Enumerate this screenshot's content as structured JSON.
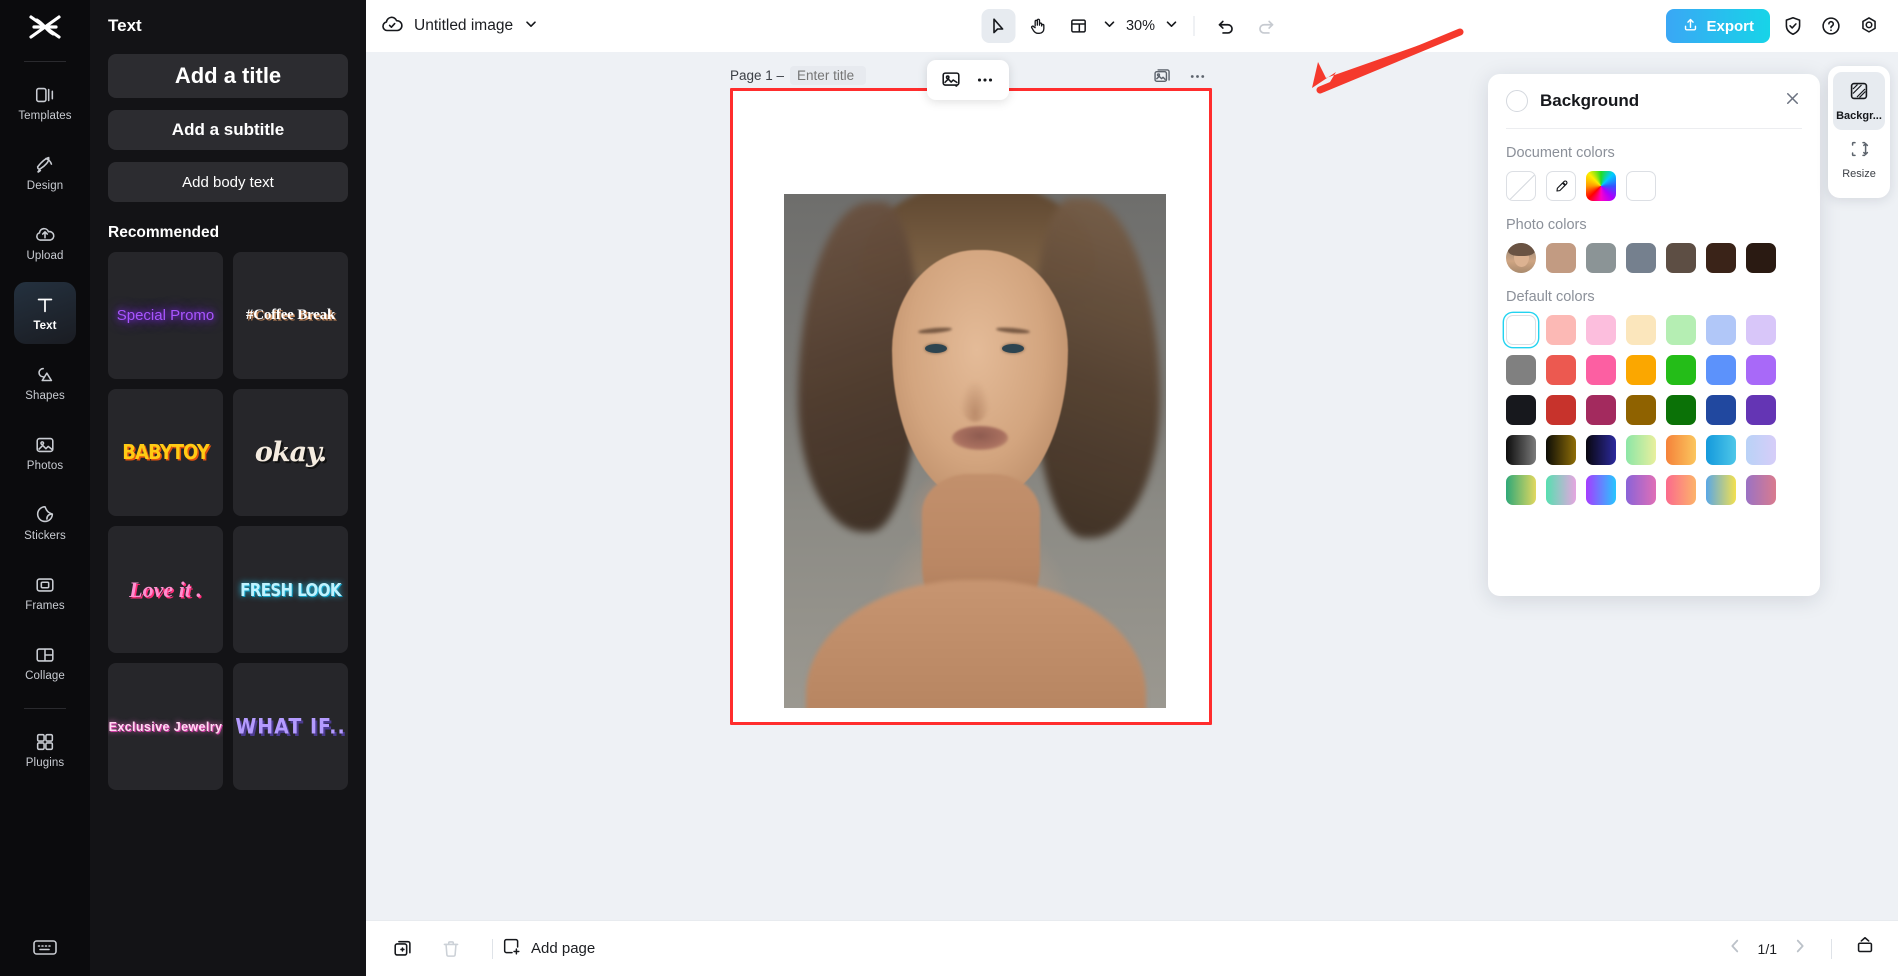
{
  "rail": {
    "logo_icon": "capcut-logo-icon",
    "items": [
      {
        "label": "Templates",
        "icon": "templates-icon",
        "active": false
      },
      {
        "label": "Design",
        "icon": "design-icon",
        "active": false
      },
      {
        "label": "Upload",
        "icon": "upload-cloud-icon",
        "active": false
      },
      {
        "label": "Text",
        "icon": "text-icon",
        "active": true
      },
      {
        "label": "Shapes",
        "icon": "shapes-icon",
        "active": false
      },
      {
        "label": "Photos",
        "icon": "photos-icon",
        "active": false
      },
      {
        "label": "Stickers",
        "icon": "stickers-icon",
        "active": false
      },
      {
        "label": "Frames",
        "icon": "frames-icon",
        "active": false
      },
      {
        "label": "Collage",
        "icon": "collage-icon",
        "active": false
      },
      {
        "label": "Plugins",
        "icon": "plugins-icon",
        "active": false
      }
    ],
    "bottom_icon": "keyboard-icon"
  },
  "panel": {
    "title": "Text",
    "buttons": [
      {
        "label": "Add a title"
      },
      {
        "label": "Add a subtitle"
      },
      {
        "label": "Add body text"
      }
    ],
    "section_title": "Recommended",
    "cards": [
      {
        "label": "Special Promo",
        "style": "s-special"
      },
      {
        "label": "#Coffee Break",
        "style": "s-coffee"
      },
      {
        "label": "BABYTOY",
        "style": "s-baby"
      },
      {
        "label": "okay.",
        "style": "s-okay"
      },
      {
        "label": "Love it .",
        "style": "s-love"
      },
      {
        "label": "FRESH LOOK",
        "style": "s-fresh"
      },
      {
        "label": "Exclusive Jewelry",
        "style": "s-jewel"
      },
      {
        "label": "WHAT IF..",
        "style": "s-what"
      }
    ]
  },
  "topbar": {
    "cloud_icon": "cloud-saved-icon",
    "doc_title": "Untitled image",
    "title_caret_icon": "chevron-down-icon",
    "select_tool_icon": "cursor-select-icon",
    "hand_tool_icon": "hand-pan-icon",
    "layout_tool_icon": "layout-grid-icon",
    "layout_caret_icon": "chevron-down-icon",
    "zoom_value": "30%",
    "zoom_caret_icon": "chevron-down-icon",
    "undo_icon": "undo-icon",
    "redo_icon": "redo-icon",
    "export_label": "Export",
    "export_icon": "upload-share-icon",
    "shield_icon": "shield-check-icon",
    "help_icon": "question-circle-icon",
    "settings_icon": "gear-icon",
    "export_color": "#2fc6ea"
  },
  "canvas": {
    "page_label": "Page 1 –",
    "page_title_placeholder": "Enter title",
    "page_title_value": "",
    "float_image_icon": "image-edit-icon",
    "float_more_icon": "more-dots-icon",
    "duplicate_icon": "duplicate-page-icon",
    "more_icon": "more-dots-icon",
    "selection_color": "#ff2d2d",
    "selection_inner_color": "#25d3ef"
  },
  "bottombar": {
    "duplicate_icon": "duplicate-page-icon",
    "delete_icon": "trash-icon",
    "add_page_icon": "add-page-icon",
    "add_page_label": "Add page",
    "prev_icon": "chevron-left-icon",
    "page_indicator": "1/1",
    "next_icon": "chevron-right-icon",
    "timeline_icon": "page-panel-icon"
  },
  "background_panel": {
    "title": "Background",
    "close_icon": "close-icon",
    "sections": {
      "document_colors": {
        "label": "Document colors",
        "swatches": [
          {
            "name": "no-color",
            "type": "none"
          },
          {
            "name": "eyedropper",
            "type": "picker"
          },
          {
            "name": "color-wheel",
            "type": "wheel"
          },
          {
            "name": "white",
            "type": "solid",
            "color": "#ffffff"
          }
        ]
      },
      "photo_colors": {
        "label": "Photo colors",
        "swatches": [
          {
            "name": "photo-thumbnail",
            "type": "avatar"
          },
          {
            "name": "tan",
            "type": "solid",
            "color": "#c29b82"
          },
          {
            "name": "slate-gray",
            "type": "solid",
            "color": "#8b9496"
          },
          {
            "name": "blue-gray",
            "type": "solid",
            "color": "#75808e"
          },
          {
            "name": "taupe",
            "type": "solid",
            "color": "#5d4e44"
          },
          {
            "name": "dark-brown",
            "type": "solid",
            "color": "#3a2318"
          },
          {
            "name": "near-black",
            "type": "solid",
            "color": "#2a1a12"
          }
        ]
      },
      "default_colors": {
        "label": "Default colors",
        "rows": [
          [
            {
              "name": "white",
              "type": "solid",
              "color": "#ffffff",
              "selected": true
            },
            {
              "name": "light-red",
              "type": "solid",
              "color": "#fcb9b5"
            },
            {
              "name": "light-pink",
              "type": "solid",
              "color": "#fcbedd"
            },
            {
              "name": "light-cream",
              "type": "solid",
              "color": "#fbe6bc"
            },
            {
              "name": "light-green",
              "type": "solid",
              "color": "#b5eeb3"
            },
            {
              "name": "light-blue",
              "type": "solid",
              "color": "#b1c7f8"
            },
            {
              "name": "light-purple",
              "type": "solid",
              "color": "#d8c6f9"
            }
          ],
          [
            {
              "name": "gray",
              "type": "solid",
              "color": "#808080"
            },
            {
              "name": "red",
              "type": "solid",
              "color": "#ec5950"
            },
            {
              "name": "pink",
              "type": "solid",
              "color": "#fc5fa2"
            },
            {
              "name": "orange",
              "type": "solid",
              "color": "#fba700"
            },
            {
              "name": "green",
              "type": "solid",
              "color": "#24bd18"
            },
            {
              "name": "blue",
              "type": "solid",
              "color": "#5c92fb"
            },
            {
              "name": "purple",
              "type": "solid",
              "color": "#a869f8"
            }
          ],
          [
            {
              "name": "black",
              "type": "solid",
              "color": "#17181d"
            },
            {
              "name": "dark-red",
              "type": "solid",
              "color": "#c7332c"
            },
            {
              "name": "magenta",
              "type": "solid",
              "color": "#a32a5e"
            },
            {
              "name": "dark-gold",
              "type": "solid",
              "color": "#8f6200"
            },
            {
              "name": "dark-green",
              "type": "solid",
              "color": "#0b7207"
            },
            {
              "name": "dark-blue",
              "type": "solid",
              "color": "#21489f"
            },
            {
              "name": "dark-purple",
              "type": "solid",
              "color": "#6435b4"
            }
          ],
          [
            {
              "name": "gradient-black-gray",
              "type": "gradient",
              "color": "linear-gradient(90deg,#0c0c0c,#7b7b7b)"
            },
            {
              "name": "gradient-black-gold",
              "type": "gradient",
              "color": "linear-gradient(90deg,#0d0d07,#8f6e07)"
            },
            {
              "name": "gradient-black-navy",
              "type": "gradient",
              "color": "linear-gradient(90deg,#09070f,#2c2a9e)"
            },
            {
              "name": "gradient-green-yellow",
              "type": "gradient",
              "color": "linear-gradient(90deg,#8ce6a7,#e9ef9d)"
            },
            {
              "name": "gradient-orange-yellow",
              "type": "gradient",
              "color": "linear-gradient(90deg,#f5823a,#fbc65e)"
            },
            {
              "name": "gradient-blue-cyan",
              "type": "gradient",
              "color": "linear-gradient(90deg,#1499dc,#4ec7e8)"
            },
            {
              "name": "gradient-lightblue-lilac",
              "type": "gradient",
              "color": "linear-gradient(90deg,#b9d2f7,#d6cdf8)"
            }
          ],
          [
            {
              "name": "gradient-teal-yellow",
              "type": "gradient",
              "color": "linear-gradient(90deg,#2fa878,#e2d85f)"
            },
            {
              "name": "gradient-mint-pink",
              "type": "gradient",
              "color": "linear-gradient(90deg,#57dfb0,#e6a5e0)"
            },
            {
              "name": "gradient-purple-cyan",
              "type": "gradient",
              "color": "linear-gradient(90deg,#a63cff,#27c6ff)"
            },
            {
              "name": "gradient-violet-rose",
              "type": "gradient",
              "color": "linear-gradient(90deg,#8a63d8,#e06fb6)"
            },
            {
              "name": "gradient-pink-orange",
              "type": "gradient",
              "color": "linear-gradient(90deg,#fb6a8d,#fcb36a)"
            },
            {
              "name": "gradient-blue-yellow",
              "type": "gradient",
              "color": "linear-gradient(90deg,#59a7e6,#f3e04f)"
            },
            {
              "name": "gradient-rose-mauve",
              "type": "gradient",
              "color": "linear-gradient(90deg,#9a72c4,#d97b8e)"
            }
          ]
        ]
      }
    }
  },
  "dock": {
    "items": [
      {
        "label": "Backgr...",
        "icon": "background-swatch-icon",
        "active": true
      },
      {
        "label": "Resize",
        "icon": "resize-icon",
        "active": false
      }
    ]
  },
  "annotation": {
    "arrow_color": "#f5392c"
  }
}
